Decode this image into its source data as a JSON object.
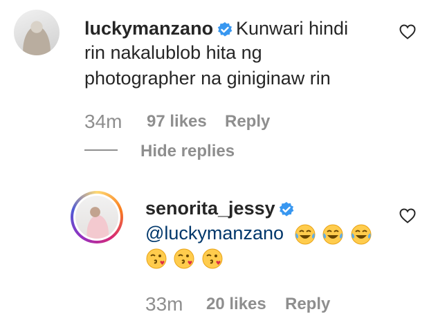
{
  "comment": {
    "username": "luckymanzano",
    "text_line1": "Kunwari hindi",
    "text_line2": "rin nakalublob hita ng",
    "text_line3": "photographer na giniginaw rin",
    "time": "34m",
    "likes": "97 likes",
    "reply_label": "Reply",
    "hide_replies_label": "Hide replies"
  },
  "reply": {
    "username": "senorita_jessy",
    "mention": "@luckymanzano",
    "time": "33m",
    "likes": "20 likes",
    "reply_label": "Reply"
  },
  "colors": {
    "verified": "#3897f0",
    "mention": "#00376b",
    "muted": "#8e8e8e",
    "text": "#262626"
  }
}
